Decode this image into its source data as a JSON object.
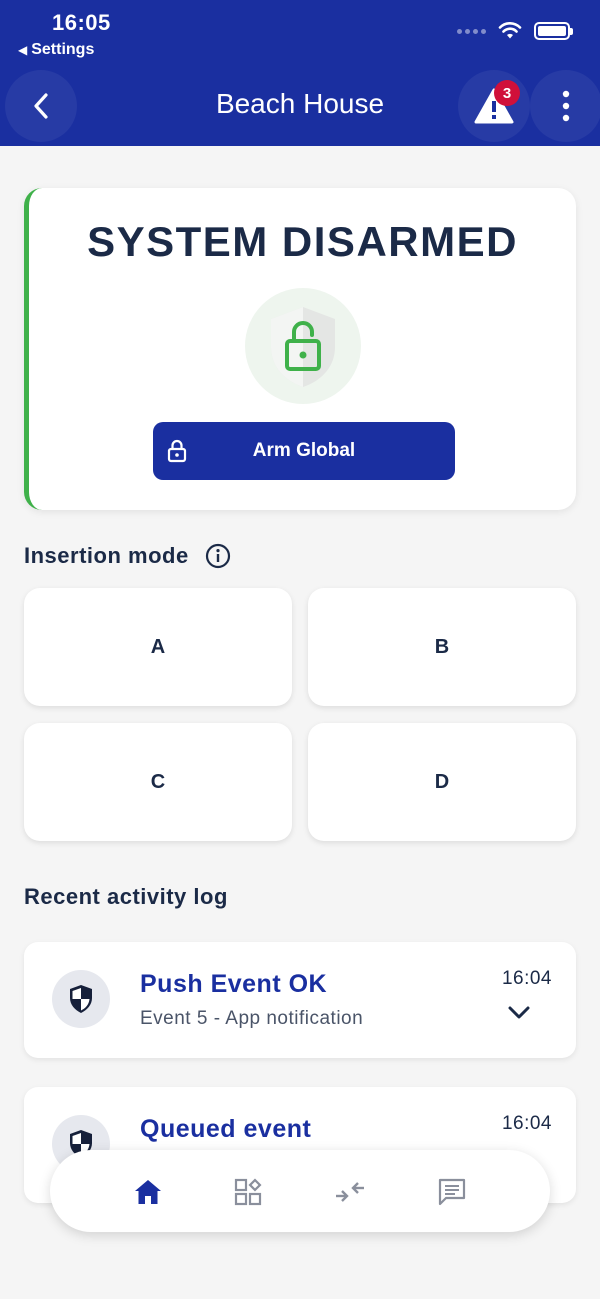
{
  "status_bar": {
    "time": "16:05",
    "back_app": "Settings"
  },
  "header": {
    "title": "Beach House",
    "alert_count": "3"
  },
  "status_card": {
    "title": "SYSTEM DISARMED",
    "arm_button_label": "Arm Global",
    "accent_color": "#3fb14a"
  },
  "insertion": {
    "title": "Insertion mode",
    "modes": [
      "A",
      "B",
      "C",
      "D"
    ]
  },
  "activity": {
    "title": "Recent activity log",
    "items": [
      {
        "title": "Push Event OK",
        "subtitle": "Event 5 - App notification",
        "time": "16:04"
      },
      {
        "title": "Queued event",
        "subtitle": "",
        "time": "16:04"
      }
    ]
  },
  "bottom_nav": {
    "items": [
      "home-icon",
      "grid-icon",
      "transfer-icon",
      "message-icon"
    ]
  },
  "colors": {
    "brand": "#1a2fa0",
    "badge": "#d0103a"
  }
}
